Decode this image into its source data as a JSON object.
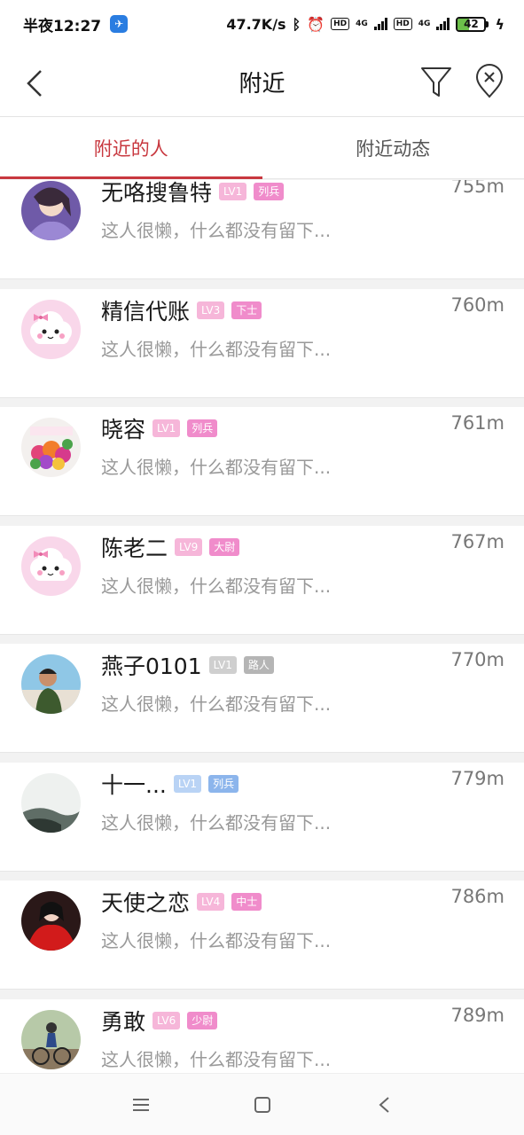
{
  "status_bar": {
    "time": "半夜12:27",
    "network_speed": "47.7K/s",
    "battery_level": "42",
    "hd1": "HD",
    "hd2": "HD",
    "net1": "4G",
    "net2": "4G"
  },
  "nav": {
    "title": "附近"
  },
  "tabs": [
    {
      "label": "附近的人",
      "active": true
    },
    {
      "label": "附近动态",
      "active": false
    }
  ],
  "users": [
    {
      "name": "无咯搜鲁特",
      "level": "LV1",
      "level_color": "#f6b6d9",
      "rank": "列兵",
      "rank_color": "#f08ccb",
      "distance": "755m",
      "bio": "这人很懒，什么都没有留下...",
      "avatar": "purple-girl"
    },
    {
      "name": "精信代账",
      "level": "LV3",
      "level_color": "#f6b6d9",
      "rank": "下士",
      "rank_color": "#f08ccb",
      "distance": "760m",
      "bio": "这人很懒，什么都没有留下...",
      "avatar": "cloud-bow"
    },
    {
      "name": "晓容",
      "level": "LV1",
      "level_color": "#f6b6d9",
      "rank": "列兵",
      "rank_color": "#f08ccb",
      "distance": "761m",
      "bio": "这人很懒，什么都没有留下...",
      "avatar": "flowers"
    },
    {
      "name": "陈老二",
      "level": "LV9",
      "level_color": "#f6b6d9",
      "rank": "大尉",
      "rank_color": "#f08ccb",
      "distance": "767m",
      "bio": "这人很懒，什么都没有留下...",
      "avatar": "cloud-bow"
    },
    {
      "name": "燕子0101",
      "level": "LV1",
      "level_color": "#cfcfcf",
      "rank": "路人",
      "rank_color": "#b5b5b5",
      "distance": "770m",
      "bio": "这人很懒，什么都没有留下...",
      "avatar": "boy"
    },
    {
      "name": "十一...",
      "level": "LV1",
      "level_color": "#b9d3f5",
      "rank": "列兵",
      "rank_color": "#8cb5ec",
      "distance": "779m",
      "bio": "这人很懒，什么都没有留下...",
      "avatar": "mist"
    },
    {
      "name": "天使之恋",
      "level": "LV4",
      "level_color": "#f6b6d9",
      "rank": "中士",
      "rank_color": "#f08ccb",
      "distance": "786m",
      "bio": "这人很懒，什么都没有留下...",
      "avatar": "red-dress"
    },
    {
      "name": "勇敢",
      "level": "LV6",
      "level_color": "#f6b6d9",
      "rank": "少尉",
      "rank_color": "#f08ccb",
      "distance": "789m",
      "bio": "这人很懒，什么都没有留下...",
      "avatar": "cyclist"
    }
  ],
  "bottom_nav": [
    "menu-icon",
    "home-square-icon",
    "back-triangle-icon"
  ]
}
